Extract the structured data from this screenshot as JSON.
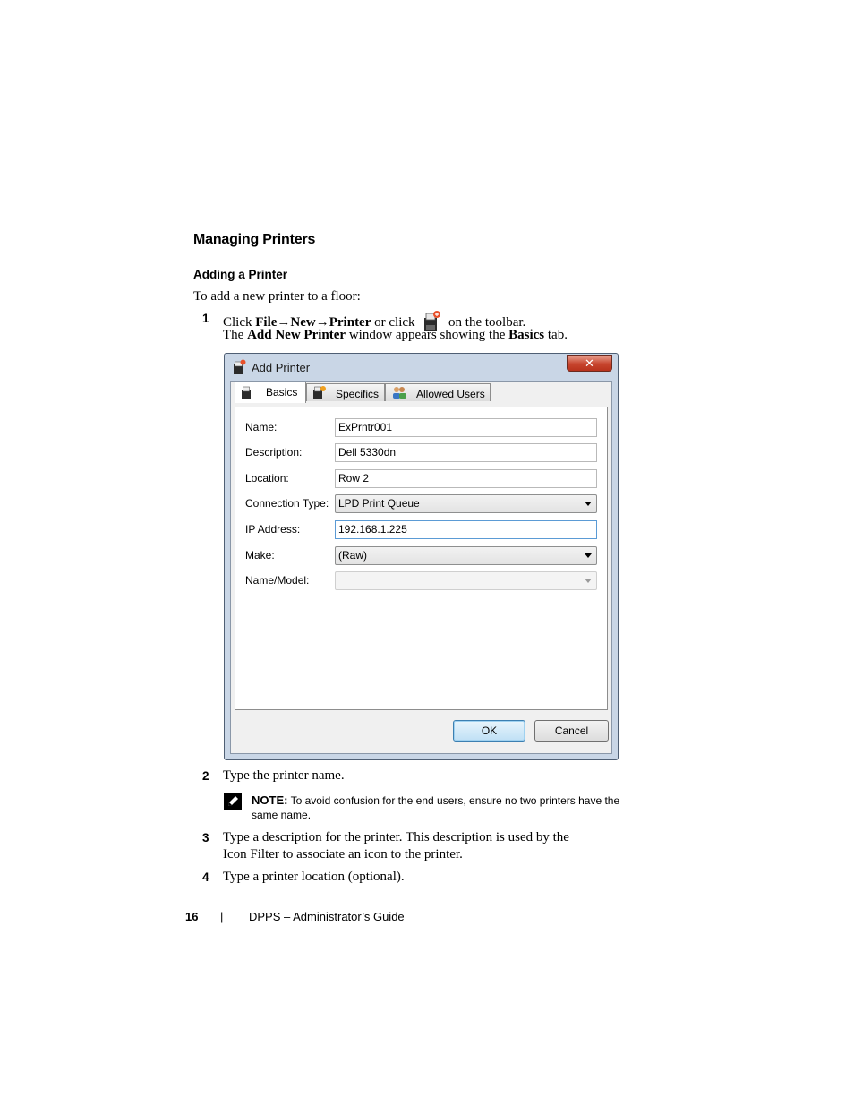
{
  "heading": "Managing Printers",
  "subheading": "Adding a Printer",
  "intro": "To add a new printer to a floor:",
  "step1": {
    "num": "1",
    "click": "Click",
    "file": "File",
    "arrow1": "→",
    "new": "New",
    "arrow2": "→",
    "printer": "Printer",
    "or_click": "or click",
    "on_toolbar": "on the toolbar.",
    "line2_the": "The",
    "line2_window": "Add New Printer",
    "line2_mid": "window appears showing the",
    "line2_tab": "Basics",
    "line2_end": "tab."
  },
  "window": {
    "title": "Add Printer",
    "close": "✕",
    "tabs": [
      {
        "label": "Basics",
        "active": true
      },
      {
        "label": "Specifics",
        "active": false
      },
      {
        "label": "Allowed Users",
        "active": false
      }
    ],
    "fields": {
      "name_label": "Name:",
      "name_value": "ExPrntr001",
      "description_label": "Description:",
      "description_value": "Dell 5330dn",
      "location_label": "Location:",
      "location_value": "Row 2",
      "connection_label": "Connection Type:",
      "connection_value": "LPD Print Queue",
      "ip_label": "IP Address:",
      "ip_value": "192.168.1.225",
      "make_label": "Make:",
      "make_value": "(Raw)",
      "model_label": "Name/Model:",
      "model_value": ""
    },
    "ok": "OK",
    "cancel": "Cancel"
  },
  "step2": {
    "num": "2",
    "text": "Type the printer name."
  },
  "note": {
    "label": "NOTE:",
    "text": "To avoid confusion for the end users, ensure no two printers have the",
    "text2": "same name."
  },
  "step3": {
    "num": "3",
    "line1": "Type a description for the printer. This description is used by the",
    "line2": "Icon Filter to associate an icon to the printer."
  },
  "step4": {
    "num": "4",
    "text": "Type a printer location (optional)."
  },
  "footer": {
    "page": "16",
    "sep": "|",
    "title": "DPPS – Administrator’s Guide"
  }
}
